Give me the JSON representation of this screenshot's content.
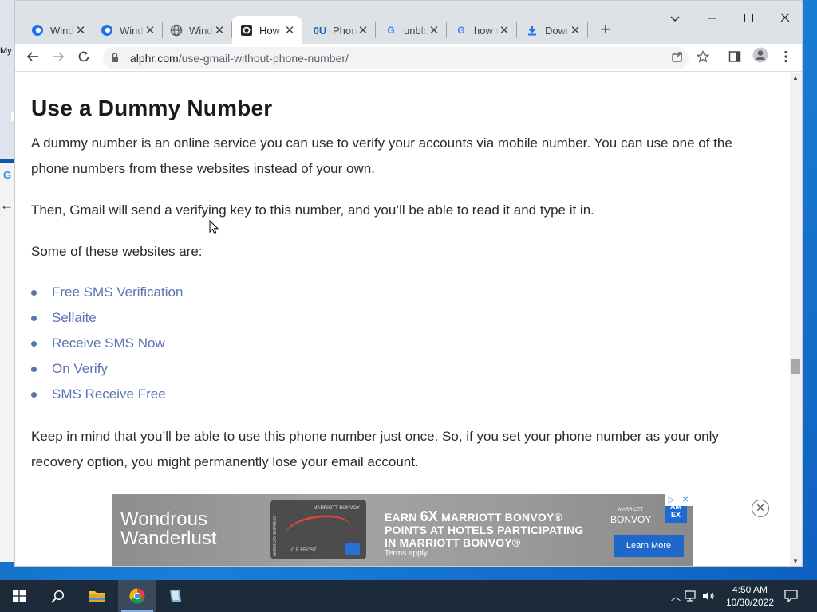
{
  "desktop": {
    "left_text": "My",
    "google_letter": "G",
    "back_arrow": "←"
  },
  "browser": {
    "tabs": [
      {
        "title": "Windows",
        "icon": "edge-swirl-icon",
        "active": false
      },
      {
        "title": "Windows",
        "icon": "edge-swirl-icon",
        "active": false
      },
      {
        "title": "Windows",
        "icon": "globe-icon",
        "active": false
      },
      {
        "title": "How to Use Gmail",
        "icon": "alphr-icon",
        "active": true
      },
      {
        "title": "Phone",
        "icon": "phone-site-icon",
        "active": false
      },
      {
        "title": "unblock",
        "icon": "google-icon",
        "active": false
      },
      {
        "title": "how to",
        "icon": "google-icon",
        "active": false
      },
      {
        "title": "Download",
        "icon": "download-icon",
        "active": false
      }
    ],
    "tab_close_glyph": "✕",
    "new_tab_glyph": "+",
    "url_host": "alphr.com",
    "url_path": "/use-gmail-without-phone-number/"
  },
  "article": {
    "heading": "Use a Dummy Number",
    "p1": "A dummy number is an online service you can use to verify your accounts via mobile number. You can use one of the phone numbers from these websites instead of your own.",
    "p2": "Then, Gmail will send a verifying key to this number, and you’ll be able to read it and type it in.",
    "p3": "Some of these websites are:",
    "sites": [
      "Free SMS Verification",
      "Sellaite",
      "Receive SMS Now",
      "On Verify",
      "SMS Receive Free"
    ],
    "p4": "Keep in mind that you’ll be able to use this phone number just once. So, if you set your phone number as your only recovery option, you might permanently lose your email account."
  },
  "ad": {
    "title_line1": "Wondrous",
    "title_line2": "Wanderlust",
    "headline_pre": "EARN ",
    "headline_big": "6X",
    "headline_line1_rest": " MARRIOTT BONVOY®",
    "headline_line2": "POINTS AT HOTELS PARTICIPATING",
    "headline_line3": "IN MARRIOTT BONVOY®",
    "terms": "Terms apply.",
    "brand_small": "MARRIOTT",
    "brand": "BONVOY",
    "amex": "AM EX",
    "cta": "Learn More",
    "card_brand": "MARRIOTT BONVOY",
    "card_name": "C F FROST",
    "card_side": "AMERICAN EXPRESS"
  },
  "taskbar": {
    "time": "4:50 AM",
    "date": "10/30/2022"
  }
}
